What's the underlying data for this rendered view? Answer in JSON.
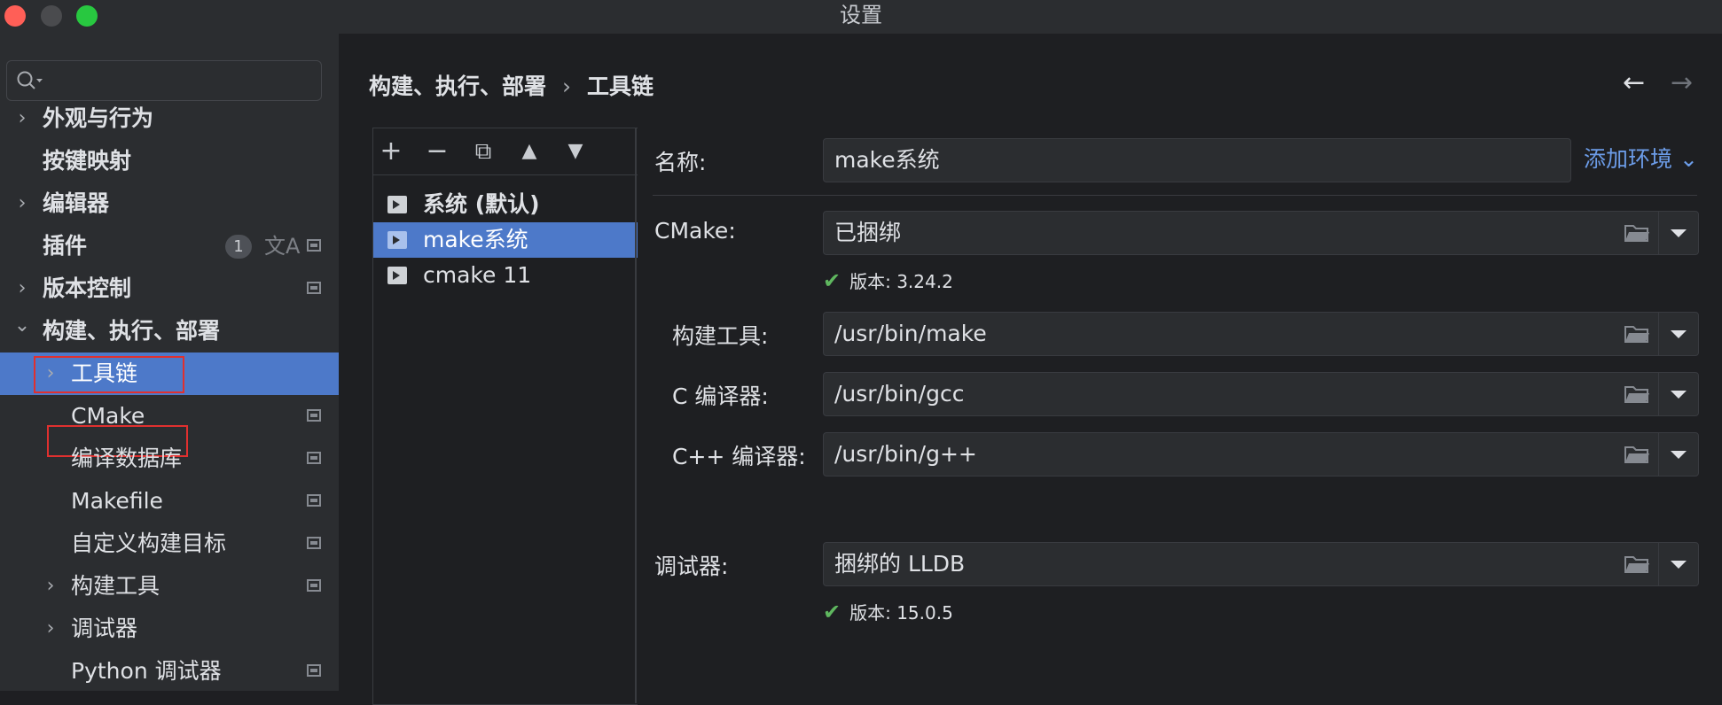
{
  "window": {
    "title": "设置"
  },
  "sidebar": {
    "search_placeholder": "",
    "items": [
      {
        "label": "外观与行为",
        "chevron": "›"
      },
      {
        "label": "按键映射"
      },
      {
        "label": "编辑器",
        "chevron": "›"
      },
      {
        "label": "插件",
        "badge": "1",
        "translate": "文A"
      },
      {
        "label": "版本控制",
        "chevron": "›"
      },
      {
        "label": "构建、执行、部署",
        "chevron": "⌄"
      },
      {
        "label": "工具链",
        "chevron": "›"
      },
      {
        "label": "CMake"
      },
      {
        "label": "编译数据库"
      },
      {
        "label": "Makefile"
      },
      {
        "label": "自定义构建目标"
      },
      {
        "label": "构建工具",
        "chevron": "›"
      },
      {
        "label": "调试器",
        "chevron": "›"
      },
      {
        "label": "Python 调试器"
      }
    ]
  },
  "breadcrumb": {
    "parent": "构建、执行、部署",
    "sep": "›",
    "current": "工具链"
  },
  "nav": {
    "back": "←",
    "forward": "→"
  },
  "toolbar": {
    "add": "+",
    "remove": "−",
    "copy": "⧉",
    "up": "▲",
    "down": "▼"
  },
  "toolchains": [
    {
      "label": "系统 (默认)"
    },
    {
      "label": "make系统"
    },
    {
      "label": "cmake 11"
    }
  ],
  "form": {
    "name_label": "名称:",
    "name_value": "make系统",
    "add_env": "添加环境 ⌄",
    "cmake_label": "CMake:",
    "cmake_value": "已捆绑",
    "cmake_version": "版本: 3.24.2",
    "build_tool_label": "构建工具:",
    "build_tool_value": "/usr/bin/make",
    "c_compiler_label": "C 编译器:",
    "c_compiler_value": "/usr/bin/gcc",
    "cpp_compiler_label": "C++ 编译器:",
    "cpp_compiler_value": "/usr/bin/g++",
    "debugger_label": "调试器:",
    "debugger_value": "捆绑的 LLDB",
    "debugger_version": "版本: 15.0.5"
  },
  "colors": {
    "selection": "#4d79c9",
    "link": "#6c9ce8",
    "check": "#5fb75f",
    "highlight_box": "#e0302f"
  }
}
